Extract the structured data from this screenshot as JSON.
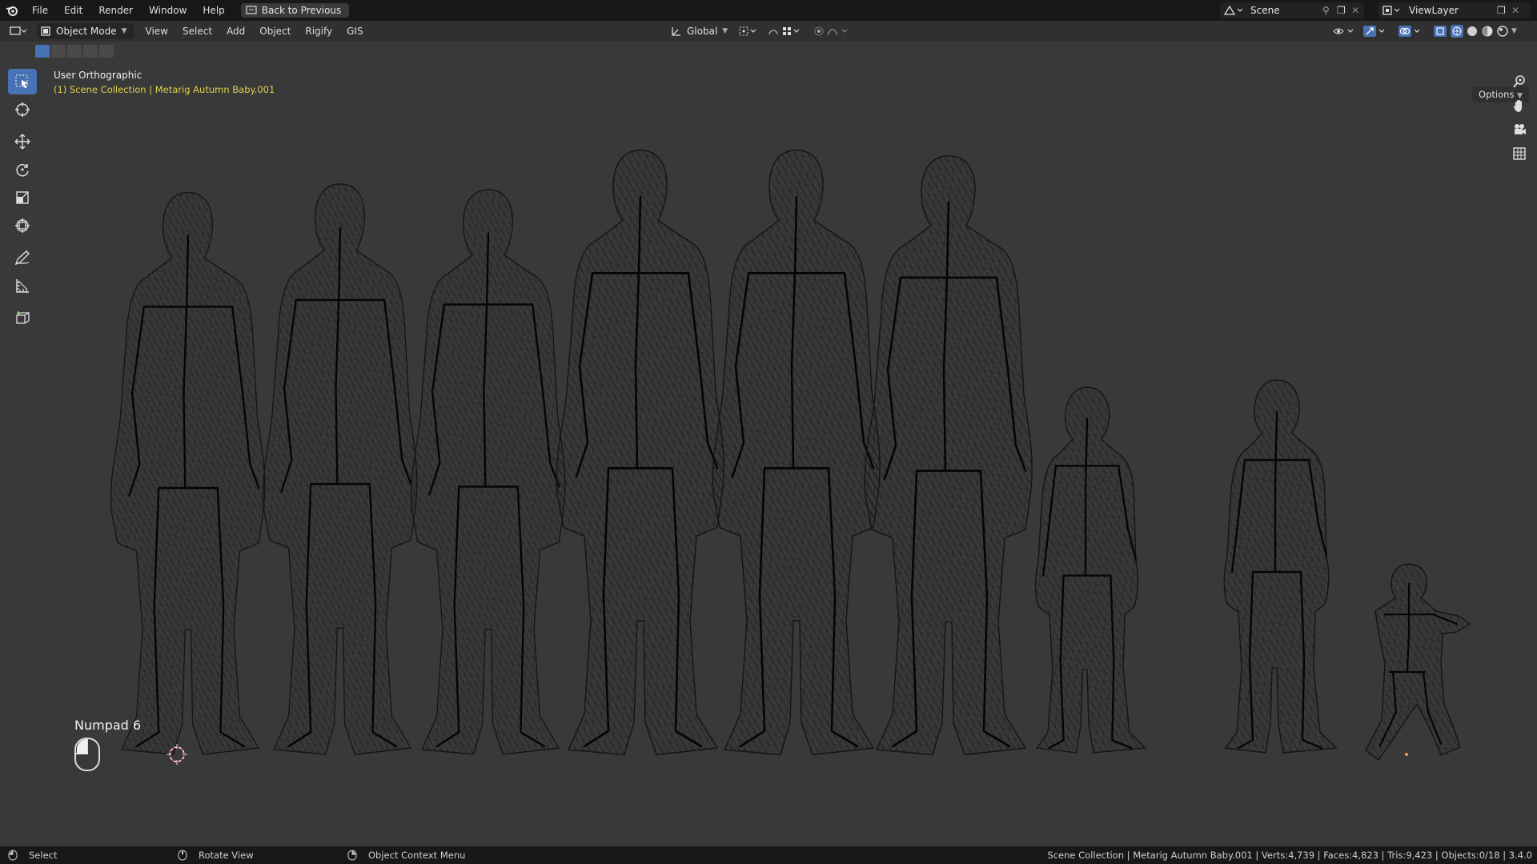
{
  "topbar": {
    "menus": [
      "File",
      "Edit",
      "Render",
      "Window",
      "Help"
    ],
    "back_button": "Back to Previous",
    "scene_label": "Scene",
    "view_layer_label": "ViewLayer"
  },
  "header": {
    "mode": "Object Mode",
    "menus": [
      "View",
      "Select",
      "Add",
      "Object",
      "Rigify",
      "GIS"
    ],
    "transform_orientation": "Global",
    "options": "Options"
  },
  "viewport": {
    "view_name": "User Orthographic",
    "collection_info": "(1) Scene Collection | Metarig Autumn Baby.001",
    "key_hint": "Numpad 6"
  },
  "toolbar": {
    "tools": [
      "select-box",
      "cursor",
      "move",
      "rotate",
      "scale",
      "transform",
      "annotate",
      "measure",
      "add-cube"
    ]
  },
  "statusbar": {
    "left_action": "Select",
    "middle_action": "Rotate View",
    "right_action": "Object Context Menu",
    "stats": "Scene Collection | Metarig Autumn Baby.001 | Verts:4,739 | Faces:4,823 | Tris:9,423 | Objects:0/18 | 3.4.0"
  },
  "colors": {
    "accent": "#4772b3",
    "collection_text": "#e2d04c",
    "wire": "#111111"
  }
}
